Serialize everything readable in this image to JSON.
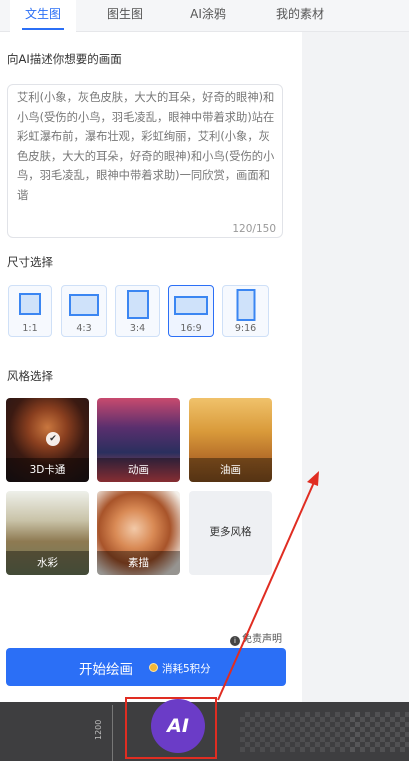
{
  "tabs": [
    {
      "label": "文生图",
      "active": true
    },
    {
      "label": "图生图",
      "active": false
    },
    {
      "label": "AI涂鸦",
      "active": false
    },
    {
      "label": "我的素材",
      "active": false
    }
  ],
  "prompt": {
    "section_title": "向AI描述你想要的画面",
    "text": "艾利(小象，灰色皮肤，大大的耳朵，好奇的眼神)和小鸟(受伤的小鸟，羽毛凌乱，眼神中带着求助)站在彩虹瀑布前，瀑布壮观，彩虹绚丽，艾利(小象，灰色皮肤，大大的耳朵，好奇的眼神)和小鸟(受伤的小鸟，羽毛凌乱，眼神中带着求助)一同欣赏，画面和谐",
    "count": "120/150"
  },
  "size": {
    "section_title": "尺寸选择",
    "options": [
      {
        "label": "1:1",
        "selected": false
      },
      {
        "label": "4:3",
        "selected": false
      },
      {
        "label": "3:4",
        "selected": false
      },
      {
        "label": "16:9",
        "selected": true
      },
      {
        "label": "9:16",
        "selected": false
      }
    ]
  },
  "style": {
    "section_title": "风格选择",
    "cards": [
      {
        "label": "3D卡通",
        "selected": true
      },
      {
        "label": "动画",
        "selected": false
      },
      {
        "label": "油画",
        "selected": false
      },
      {
        "label": "水彩",
        "selected": false
      },
      {
        "label": "素描",
        "selected": false
      },
      {
        "label": "更多风格",
        "selected": false
      }
    ]
  },
  "disclaimer": "免责声明",
  "start": {
    "label": "开始绘画",
    "cost": "消耗5积分"
  },
  "bottom": {
    "ruler": "1200",
    "logo": "AI"
  },
  "colors": {
    "accent": "#2b6ff6",
    "annotation": "#e02d22",
    "logo_bg": "#6b3cc7"
  }
}
